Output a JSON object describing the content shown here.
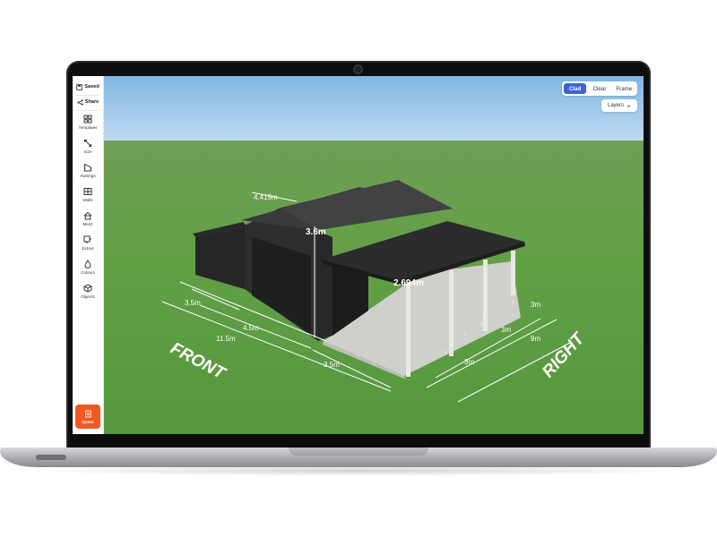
{
  "sidebar": {
    "saved_label": "Saved",
    "share_label": "Share",
    "items": [
      {
        "label": "Templates",
        "icon": "templates-icon"
      },
      {
        "label": "Size",
        "icon": "resize-icon"
      },
      {
        "label": "Awnings",
        "icon": "awning-icon"
      },
      {
        "label": "Walls",
        "icon": "walls-icon"
      },
      {
        "label": "Mezz",
        "icon": "mezzanine-icon"
      },
      {
        "label": "Extras",
        "icon": "extras-icon"
      },
      {
        "label": "Colours",
        "icon": "colour-drop-icon"
      },
      {
        "label": "Objects",
        "icon": "cube-icon"
      }
    ],
    "quote_label": "Quote"
  },
  "view_modes": {
    "options": [
      "Clad",
      "Clear",
      "Frame"
    ],
    "active": "Clad"
  },
  "layers_label": "Layers",
  "dimensions": {
    "ridge_width": "4.419m",
    "wall_height": "3.6m",
    "awning_height": "2.694m",
    "left_bay": "3.5m",
    "mid_bay": "4.5m",
    "total_length": "11.5m",
    "front_bay": "3.5m",
    "right_top": "3m",
    "right_mid": "3m",
    "right_total": "9m",
    "right_bottom": "3m"
  },
  "side_labels": {
    "front": "FRONT",
    "right": "RIGHT"
  },
  "post_numbers": [
    "1",
    "1",
    "2",
    "1",
    "1"
  ],
  "colors": {
    "accent": "#3a63d8",
    "quote": "#f05a22",
    "grass": "#5d9a43",
    "sky": "#8fc1e6",
    "shed": "#2b2b2d"
  }
}
